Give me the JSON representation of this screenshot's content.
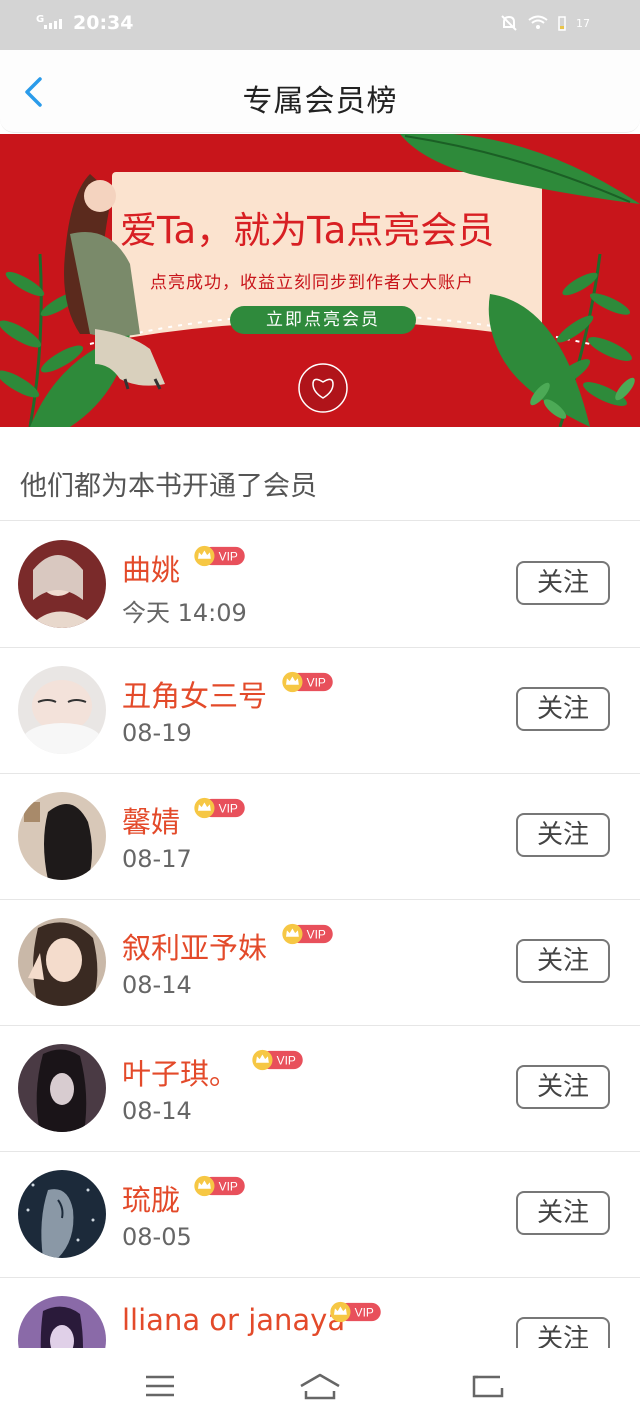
{
  "status_bar": {
    "signal_label": "G",
    "time": "20:34",
    "battery_level": "17",
    "icons": [
      "signal-icon",
      "mute-bell-icon",
      "wifi-icon",
      "battery-icon"
    ]
  },
  "header": {
    "title": "专属会员榜",
    "back_icon": "chevron-left-icon"
  },
  "banner": {
    "headline": "爱Ta，就为Ta点亮会员",
    "subtitle": "点亮成功，收益立刻同步到作者大大账户",
    "cta_label": "立即点亮会员"
  },
  "section": {
    "title": "他们都为本书开通了会员"
  },
  "badge_label": "VIP",
  "follow_label": "关注",
  "members": [
    {
      "name": "曲姚",
      "date": "今天 14:09"
    },
    {
      "name": "丑角女三号",
      "date": "08-19"
    },
    {
      "name": "馨婧",
      "date": "08-17"
    },
    {
      "name": "叙利亚予妹",
      "date": "08-14"
    },
    {
      "name": "叶子琪。",
      "date": "08-14"
    },
    {
      "name": "琉胧",
      "date": "08-05"
    },
    {
      "name": "lliana or janaya",
      "date": ""
    }
  ],
  "colors": {
    "accent_name": "#e34a2a",
    "banner_red": "#c8151b",
    "cta_green": "#2f8a3c",
    "back_blue": "#2a9bea"
  },
  "system_nav": [
    "menu-icon",
    "home-icon",
    "back-icon"
  ]
}
